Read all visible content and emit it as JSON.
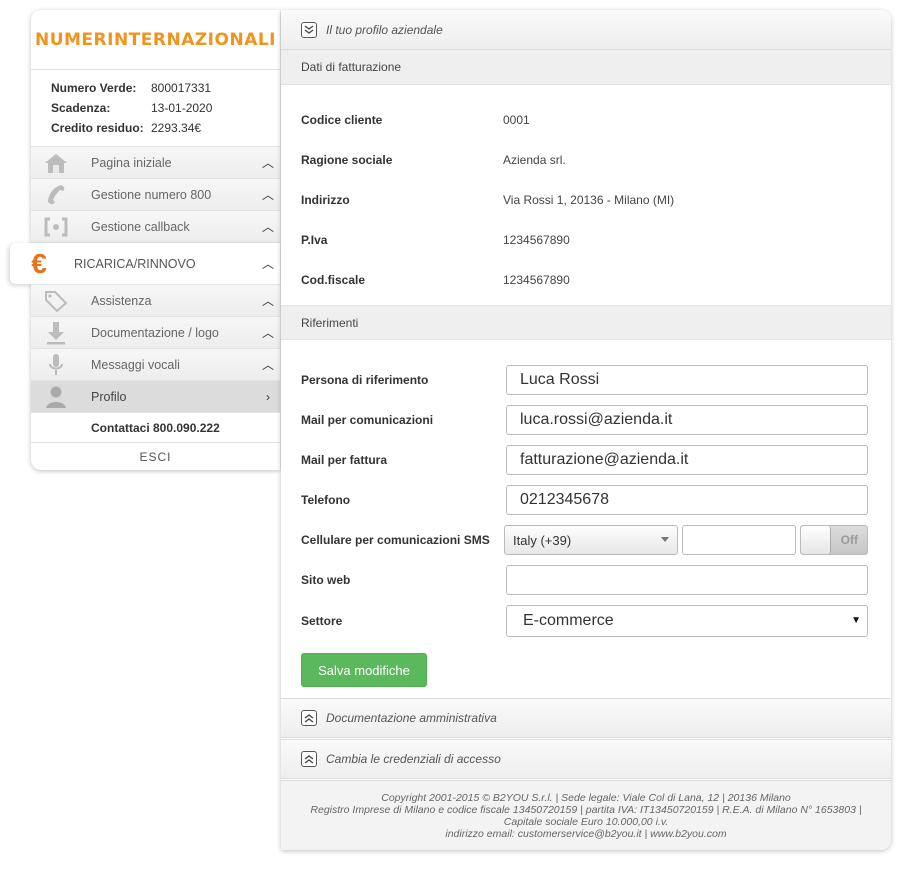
{
  "brand": {
    "logo_text": "NUMERINTERNAZIONALI",
    "accent": "#f0941e"
  },
  "account": {
    "rows": [
      {
        "label": "Numero Verde:",
        "value": "800017331"
      },
      {
        "label": "Scadenza:",
        "value": "13-01-2020"
      },
      {
        "label": "Credito residuo:",
        "value": "2293.34€"
      }
    ]
  },
  "nav": {
    "items": [
      {
        "label": "Pagina iniziale",
        "icon": "home-icon"
      },
      {
        "label": "Gestione numero 800",
        "icon": "phone-icon"
      },
      {
        "label": "Gestione callback",
        "icon": "callback-icon"
      },
      {
        "label": "RICARICA/RINNOVO",
        "icon": "euro-icon",
        "glyph": "€"
      },
      {
        "label": "Assistenza",
        "icon": "tag-icon"
      },
      {
        "label": "Documentazione / logo",
        "icon": "download-icon"
      },
      {
        "label": "Messaggi vocali",
        "icon": "microphone-icon"
      },
      {
        "label": "Profilo",
        "icon": "user-icon"
      }
    ],
    "contact": "Contattaci 800.090.222",
    "logout": "ESCI"
  },
  "profile_section": {
    "title": "Il tuo profilo aziendale"
  },
  "billing": {
    "title": "Dati di fatturazione",
    "rows": [
      {
        "label": "Codice cliente",
        "value": "0001"
      },
      {
        "label": "Ragione sociale",
        "value": "Azienda srl."
      },
      {
        "label": "Indirizzo",
        "value": "Via Rossi 1, 20136 - Milano (MI)"
      },
      {
        "label": "P.Iva",
        "value": "1234567890"
      },
      {
        "label": "Cod.fiscale",
        "value": "1234567890"
      }
    ]
  },
  "references": {
    "title": "Riferimenti",
    "person_label": "Persona di riferimento",
    "person_value": "Luca Rossi",
    "mail_label": "Mail per comunicazioni",
    "mail_value": "luca.rossi@azienda.it",
    "invoice_mail_label": "Mail per fattura",
    "invoice_mail_value": "fatturazione@azienda.it",
    "phone_label": "Telefono",
    "phone_value": "0212345678",
    "mobile_label": "Cellulare per comunicazioni SMS",
    "mobile_country": "Italy (+39)",
    "mobile_value": "",
    "sms_toggle": "Off",
    "website_label": "Sito web",
    "website_value": "",
    "sector_label": "Settore",
    "sector_value": "E-commerce",
    "save_label": "Salva modifiche",
    "save_color": "#5cb85c"
  },
  "collapsed_sections": {
    "docs": "Documentazione amministrativa",
    "credentials": "Cambia le credenziali di accesso"
  },
  "footer": {
    "line1": "Copyright 2001-2015 © B2YOU S.r.l. | Sede legale: Viale Col di Lana, 12 | 20136 Milano",
    "line2": "Registro Imprese di Milano e codice fiscale 13450720159 | partita IVA: IT13450720159 | R.E.A. di Milano N° 1653803 |",
    "line3": "Capitale sociale Euro 10.000,00 i.v.",
    "line4": "indirizzo email: customerservice@b2you.it | www.b2you.com"
  }
}
